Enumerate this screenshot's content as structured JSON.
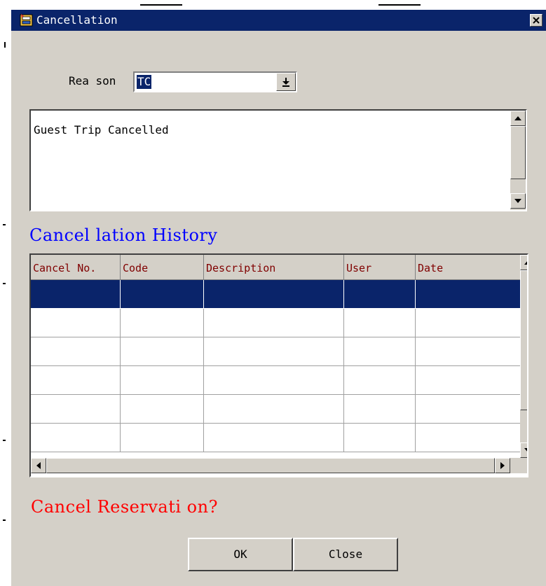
{
  "window": {
    "title": "Cancellation",
    "title_icon": "app-icon",
    "close_icon": "close-icon"
  },
  "reason": {
    "label": "Rea son",
    "value": "TC",
    "dropdown_icon": "chevron-down-icon"
  },
  "memo": {
    "text": "Guest Trip Cancelled"
  },
  "history": {
    "title": "Cancel lation History",
    "columns": [
      "Cancel No.",
      "Code",
      "Description",
      "User",
      "Date"
    ],
    "rows": [
      [
        "",
        "",
        "",
        "",
        ""
      ],
      [
        "",
        "",
        "",
        "",
        ""
      ],
      [
        "",
        "",
        "",
        "",
        ""
      ],
      [
        "",
        "",
        "",
        "",
        ""
      ],
      [
        "",
        "",
        "",
        "",
        ""
      ],
      [
        "",
        "",
        "",
        "",
        ""
      ]
    ],
    "selected_row": 0
  },
  "prompt": {
    "text": "Cancel Reservati on?"
  },
  "buttons": {
    "ok": "OK",
    "close": "Close"
  },
  "colors": {
    "title_bar": "#0a246a",
    "history_title": "#0000ff",
    "prompt": "#ff0000",
    "header_text": "#800000",
    "face": "#d4d0c8"
  }
}
